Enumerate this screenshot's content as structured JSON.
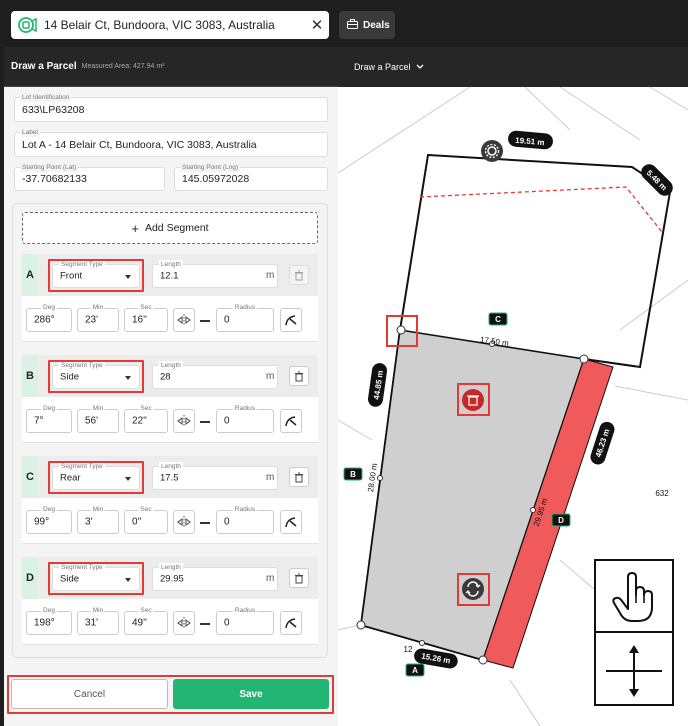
{
  "search": {
    "address": "14 Belair Ct, Bundoora, VIC 3083, Australia",
    "logo_icon": "parcel-logo-icon",
    "clear_icon": "close-icon"
  },
  "topbar": {
    "deals_label": "Deals"
  },
  "panel": {
    "title": "Draw a Parcel",
    "measured_area": "Measured Area: 427.94 m²"
  },
  "form": {
    "lot_identification": {
      "label": "Lot Identification",
      "value": "633\\LP63208"
    },
    "label": {
      "label": "Label",
      "value": "Lot A - 14 Belair Ct, Bundoora, VIC 3083, Australia"
    },
    "start_lat": {
      "label": "Starting Point (Lat)",
      "value": "-37.70682133"
    },
    "start_lng": {
      "label": "Starting Point (Lng)",
      "value": "145.05972028"
    },
    "add_segment_label": "Add Segment"
  },
  "field_labels": {
    "segment_type": "Segment Type",
    "length": "Length",
    "unit": "m",
    "deg": "Deg",
    "min": "Min",
    "sec": "Sec",
    "radius": "Radius"
  },
  "segments": [
    {
      "letter": "A",
      "type": "Front",
      "length": "12.1",
      "deg": "286°",
      "min": "23'",
      "sec": "16''",
      "radius": "0",
      "delete_disabled": true
    },
    {
      "letter": "B",
      "type": "Side",
      "length": "28",
      "deg": "7°",
      "min": "56'",
      "sec": "22''",
      "radius": "0",
      "delete_disabled": false
    },
    {
      "letter": "C",
      "type": "Rear",
      "length": "17.5",
      "deg": "99°",
      "min": "3'",
      "sec": "0''",
      "radius": "0",
      "delete_disabled": false
    },
    {
      "letter": "D",
      "type": "Side",
      "length": "29.95",
      "deg": "198°",
      "min": "31'",
      "sec": "49''",
      "radius": "0",
      "delete_disabled": false
    }
  ],
  "footer": {
    "cancel_label": "Cancel",
    "save_label": "Save"
  },
  "map": {
    "header_label": "Draw a Parcel",
    "edge_labels": {
      "top": "19.51 m",
      "right_top": "5.48 m",
      "inner_top": "17.50 m",
      "left_outer": "44.85 m",
      "left_inner": "28.00 m",
      "right_red": "46.23 m",
      "diag": "29.95 m",
      "bottom": "15.26 m",
      "bottom_small": "12"
    },
    "segment_markers": [
      "A",
      "B",
      "C",
      "D"
    ],
    "neighbour_lot": "632"
  },
  "colors": {
    "accent_green": "#22b573",
    "highlight_red": "#e53935",
    "parcel_fill": "#cfcfcf",
    "edge_red": "#f05a5a"
  }
}
